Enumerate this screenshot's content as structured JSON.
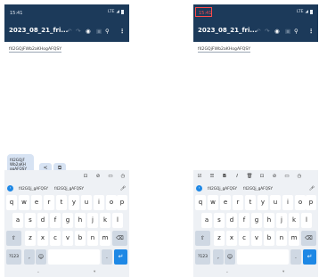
{
  "status": {
    "time": "15:41",
    "network": "LTE"
  },
  "app": {
    "title": "2023_08_21_fri..."
  },
  "document": {
    "text": "f42GQjFWb2aKHogAFQSY"
  },
  "popup": {
    "selected_text": "f42GQjF Wb2aKH ogAFQSY"
  },
  "suggestions": [
    "f42GQj_gAFQSY",
    "f42GQj_gAFQSY"
  ],
  "keyboard": {
    "row1": [
      "q",
      "w",
      "e",
      "r",
      "t",
      "y",
      "u",
      "i",
      "o",
      "p"
    ],
    "row2": [
      "a",
      "s",
      "d",
      "f",
      "g",
      "h",
      "j",
      "k",
      "l"
    ],
    "row3": [
      "z",
      "x",
      "c",
      "v",
      "b",
      "n",
      "m"
    ],
    "num_label": "?123",
    "comma": ",",
    "period": "."
  },
  "icons": {
    "undo": "undo-icon",
    "redo": "redo-icon",
    "eye": "eye-icon",
    "save": "save-icon",
    "search": "search-icon",
    "more": "more-vert-icon",
    "share": "share-icon",
    "copy": "copy-icon",
    "mic": "mic-icon",
    "shift": "shift-icon",
    "backspace": "backspace-icon",
    "emoji": "emoji-icon",
    "enter": "enter-icon"
  },
  "colors": {
    "appbar": "#1c3a5a",
    "accent": "#1e88e5",
    "recording": "#ff4b4b"
  }
}
